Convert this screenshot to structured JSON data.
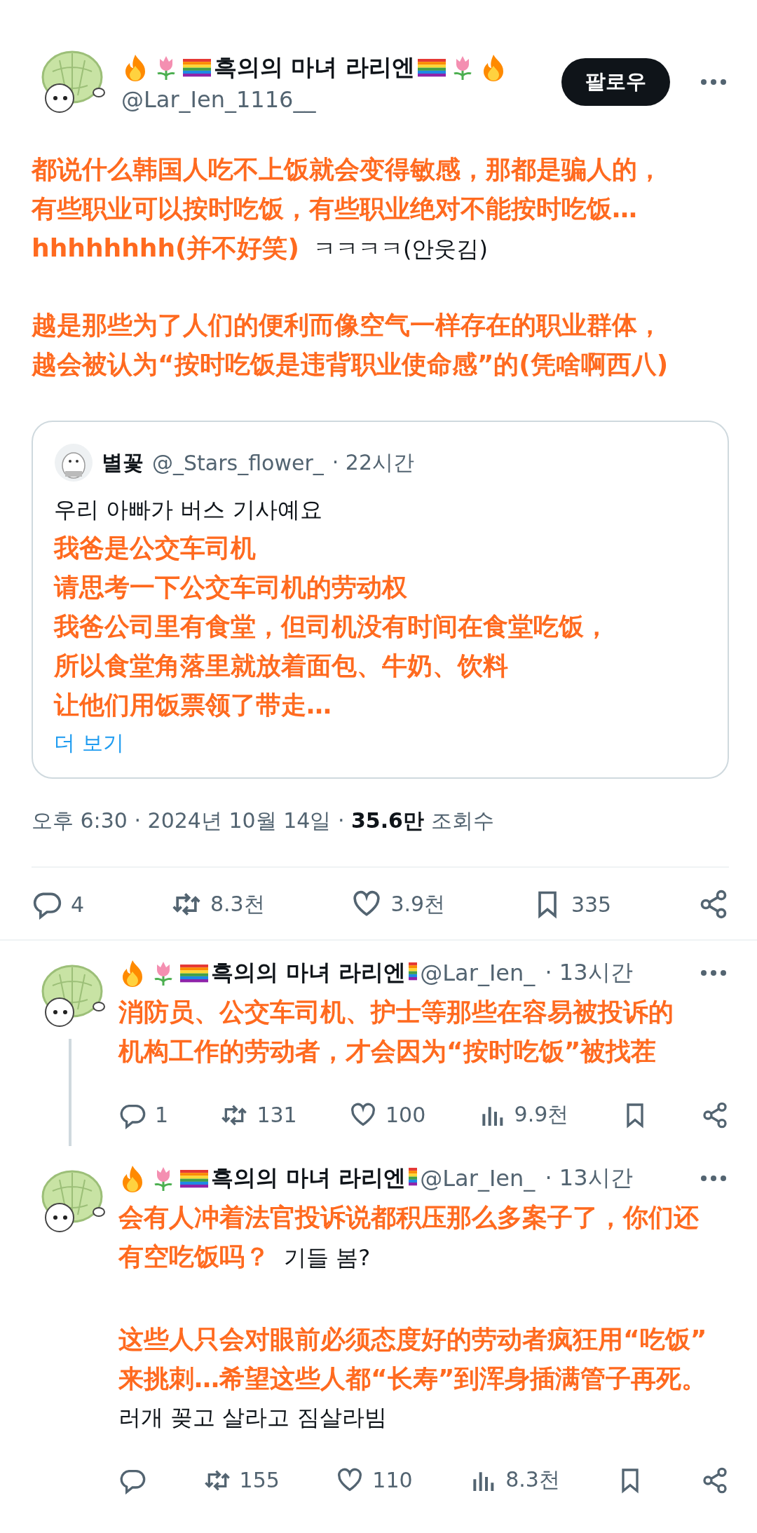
{
  "post": {
    "author": {
      "name": "흑의의 마녀 라리엔",
      "handle": "@Lar_Ien_1116__"
    },
    "follow_button": "팔로우",
    "body": [
      [
        {
          "kind": "overlay",
          "text": "都说什么韩国人吃不上饭就会变得敏感，那都是骗人的，"
        },
        {
          "kind": "overlay",
          "text": "有些职业可以按时吃饭，有些职业绝对不能按时吃饭…"
        },
        {
          "kind": "overlay",
          "text": "hhhhhhhh(并不好笑)",
          "tail": "ㅋㅋㅋㅋ(안웃김)"
        }
      ],
      [
        {
          "kind": "overlay",
          "text": "越是那些为了人们的便利而像空气一样存在的职业群体，"
        },
        {
          "kind": "overlay",
          "text": "越会被认为“按时吃饭是违背职业使命感”的(凭啥啊西八)"
        }
      ]
    ],
    "quote": {
      "author": {
        "name": "별꽃",
        "handle": "@_Stars_flower_",
        "separator": "·",
        "time": "22시간"
      },
      "body": [
        [
          {
            "kind": "original",
            "text": "우리 아빠가 버스 기사예요"
          },
          {
            "kind": "overlay",
            "text": "我爸是公交车司机"
          },
          {
            "kind": "overlay",
            "text": "请思考一下公交车司机的劳动权"
          },
          {
            "kind": "overlay",
            "text": "我爸公司里有食堂，但司机没有时间在食堂吃饭，"
          },
          {
            "kind": "overlay",
            "text": "所以食堂角落里就放着面包、牛奶、饮料"
          },
          {
            "kind": "overlay",
            "text": "让他们用饭票领了带走…"
          }
        ]
      ],
      "more_link": "더 보기"
    },
    "meta": {
      "time": "오후 6:30",
      "separator": "·",
      "date": "2024년 10월 14일",
      "views": "35.6만",
      "views_label": "조회수"
    },
    "actions": {
      "replies": "4",
      "reposts": "8.3천",
      "likes": "3.9천",
      "bookmarks": "335"
    }
  },
  "replies": [
    {
      "author": {
        "name": "흑의의 마녀 라리엔",
        "handle": "@Lar_Ien_",
        "separator": "·",
        "time": "13시간"
      },
      "thread_line": true,
      "body": [
        [
          {
            "kind": "overlay",
            "text": "消防员、公交车司机、护士等那些在容易被投诉的"
          },
          {
            "kind": "overlay",
            "text": "机构工作的劳动者，才会因为“按时吃饭”被找茬"
          }
        ]
      ],
      "actions": {
        "replies": "1",
        "reposts": "131",
        "likes": "100",
        "views": "9.9천"
      }
    },
    {
      "author": {
        "name": "흑의의 마녀 라리엔",
        "handle": "@Lar_Ien_",
        "separator": "·",
        "time": "13시간"
      },
      "thread_line": false,
      "body": [
        [
          {
            "kind": "overlay",
            "text": "会有人冲着法官投诉说都积压那么多案子了，你们还"
          },
          {
            "kind": "overlay",
            "text": "有空吃饭吗？",
            "tail": "기들 봄?"
          }
        ],
        [
          {
            "kind": "overlay",
            "text": "这些人只会对眼前必须态度好的劳动者疯狂用“吃饭”"
          },
          {
            "kind": "overlay",
            "text": "来挑刺…希望这些人都“长寿”到浑身插满管子再死。"
          },
          {
            "kind": "original",
            "text": "러개 꽂고 살라고 짐살라빔"
          }
        ]
      ],
      "actions": {
        "reposts": "155",
        "likes": "110",
        "views": "8.3천"
      }
    }
  ]
}
